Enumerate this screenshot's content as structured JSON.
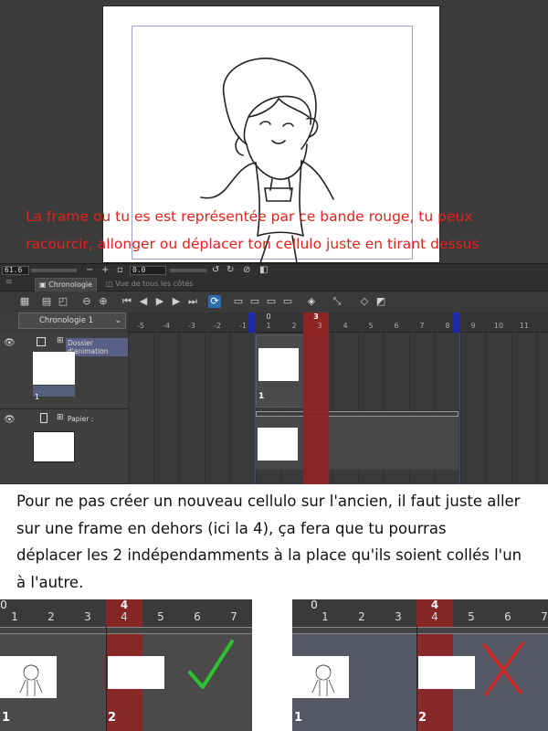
{
  "canvas": {
    "annotation_line1": "La frame ou tu es est représentée par ce bande rouge, tu peux",
    "annotation_line2": "racourcir, allonger ou déplacer ton cellulo juste en tirant dessus",
    "annotation_color": "#e0231c"
  },
  "zoom_bar": {
    "zoom_value": "61.6",
    "rotation_value": "0.0"
  },
  "panel": {
    "tab_active": "Chronologie",
    "tab_inactive": "Vue de tous les côtés",
    "timeline_select": "Chronologie 1",
    "ruler_numbers": [
      "-5",
      "-4",
      "-3",
      "-2",
      "-1",
      "1",
      "2",
      "3",
      "4",
      "5",
      "6",
      "7",
      "8",
      "9",
      "10",
      "11"
    ],
    "ruler_zero": "0",
    "ruler_current": "3",
    "ruler_end": "8",
    "layers": [
      {
        "name": "Dossier d'animation",
        "cel_number": "1"
      },
      {
        "name": "Papier :"
      }
    ],
    "cel_label": "1"
  },
  "explanation": {
    "line1": "Pour ne pas créer un nouveau cellulo sur l'ancien, il faut juste aller",
    "line2": "sur une frame en dehors (ici la 4), ça fera que tu pourras",
    "line3": "déplacer les 2 indépendamments à la place qu'ils soient collés l'un",
    "line4": "à l'autre."
  },
  "examples": {
    "good": {
      "zero": "0",
      "numbers": [
        "1",
        "2",
        "3",
        "4",
        "5",
        "6",
        "7"
      ],
      "current_top": "4",
      "cel_a": "1",
      "cel_b": "2",
      "mark": "check"
    },
    "bad": {
      "zero": "0",
      "numbers": [
        "1",
        "2",
        "3",
        "4",
        "5",
        "6",
        "7"
      ],
      "current_top": "4",
      "cel_a": "1",
      "cel_b": "2",
      "mark": "cross"
    }
  },
  "colors": {
    "playhead": "#8e2424",
    "range_marker": "#1c2bb0",
    "check": "#2fc22f",
    "cross": "#d8231c"
  },
  "icons": [
    "eye-icon",
    "layer-icon",
    "play-icon",
    "first-frame-icon",
    "prev-frame-icon",
    "next-frame-icon",
    "last-frame-icon",
    "loop-icon",
    "zoom-in-icon",
    "zoom-out-icon"
  ]
}
